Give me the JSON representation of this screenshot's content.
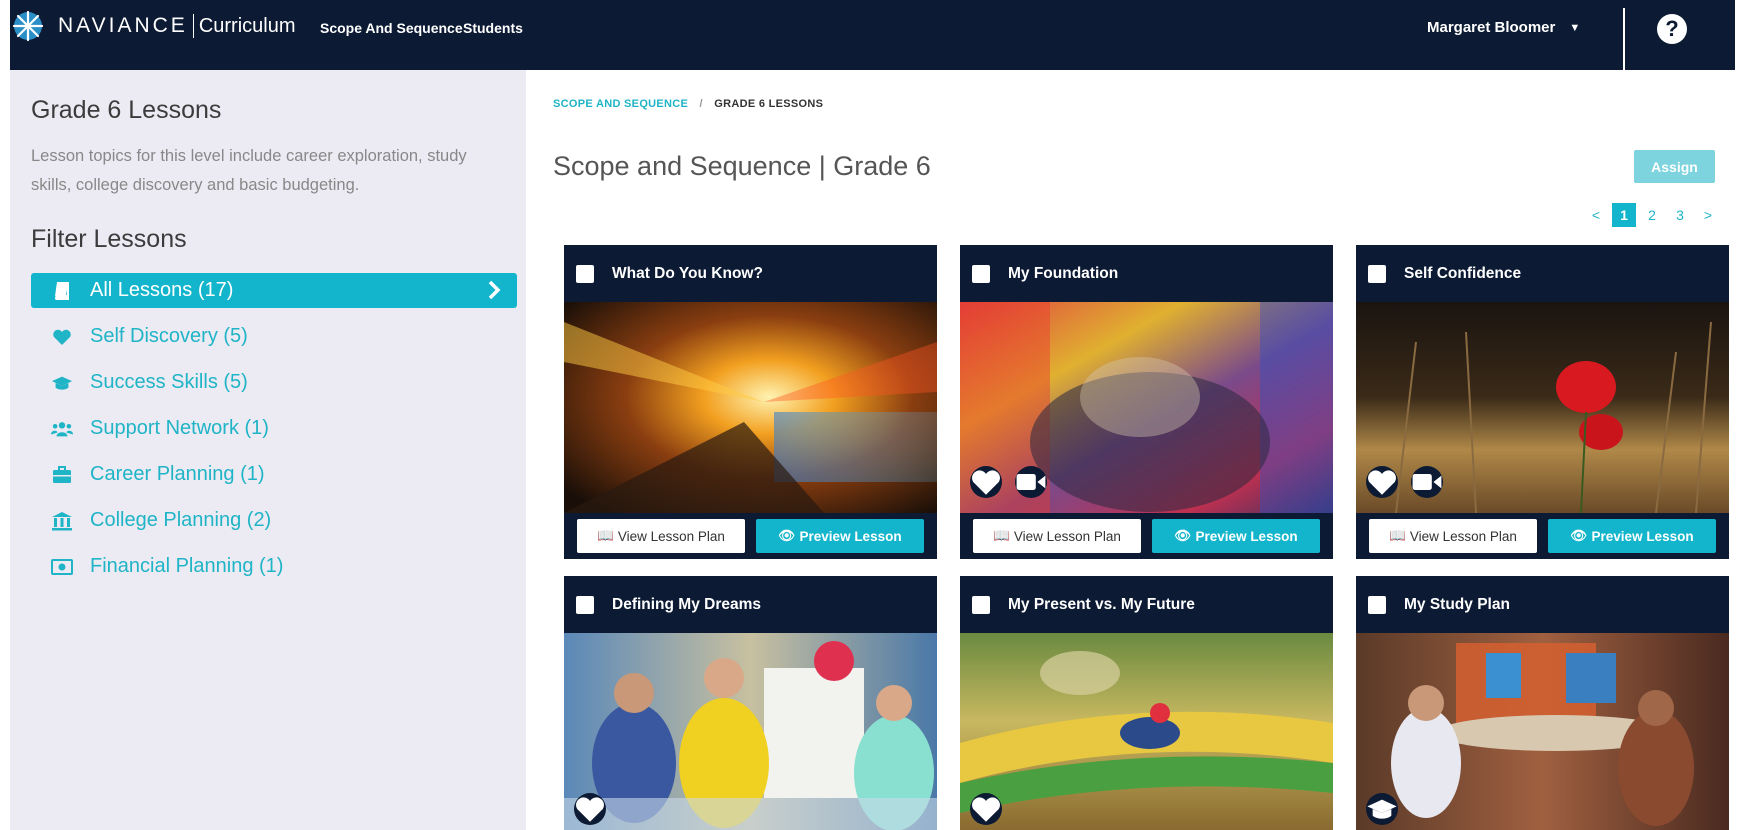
{
  "header": {
    "brand": "NAVIANCE",
    "product": "Curriculum",
    "nav": [
      "Scope And Sequence",
      "Students"
    ],
    "user": "Margaret Bloomer",
    "help_symbol": "?"
  },
  "sidebar": {
    "title": "Grade 6 Lessons",
    "description": "Lesson topics for this level include career exploration, study skills, college discovery and basic budgeting.",
    "filter_title": "Filter Lessons",
    "filters": [
      {
        "label": "All Lessons (17)",
        "icon": "book-icon",
        "active": true
      },
      {
        "label": "Self Discovery (5)",
        "icon": "heart-icon"
      },
      {
        "label": "Success Skills (5)",
        "icon": "graduation-cap-icon"
      },
      {
        "label": "Support Network (1)",
        "icon": "people-icon"
      },
      {
        "label": "Career Planning (1)",
        "icon": "briefcase-icon"
      },
      {
        "label": "College Planning (2)",
        "icon": "institution-icon"
      },
      {
        "label": "Financial Planning (1)",
        "icon": "money-icon"
      }
    ]
  },
  "breadcrumb": {
    "root": "SCOPE AND SEQUENCE",
    "separator": "/",
    "current": "GRADE 6 LESSONS"
  },
  "page_title": "Scope and Sequence | Grade 6",
  "assign_label": "Assign",
  "pagination": {
    "prev": "<",
    "pages": [
      "1",
      "2",
      "3"
    ],
    "current": "1",
    "next": ">"
  },
  "lessons": [
    {
      "title": "What Do You Know?",
      "badges": []
    },
    {
      "title": "My Foundation",
      "badges": [
        "heart-icon",
        "video-icon"
      ]
    },
    {
      "title": "Self Confidence",
      "badges": [
        "heart-icon",
        "video-icon"
      ]
    },
    {
      "title": "Defining My Dreams",
      "badges": [
        "heart-icon"
      ]
    },
    {
      "title": "My Present vs. My Future",
      "badges": [
        "heart-icon"
      ]
    },
    {
      "title": "My Study Plan",
      "badges": [
        "graduation-cap-icon"
      ]
    }
  ],
  "card_actions": {
    "view_plan": "View Lesson Plan",
    "preview": "Preview Lesson"
  },
  "colors": {
    "navy": "#0c1a33",
    "accent": "#13b5cc",
    "sidebar_bg": "#ecebf4"
  }
}
